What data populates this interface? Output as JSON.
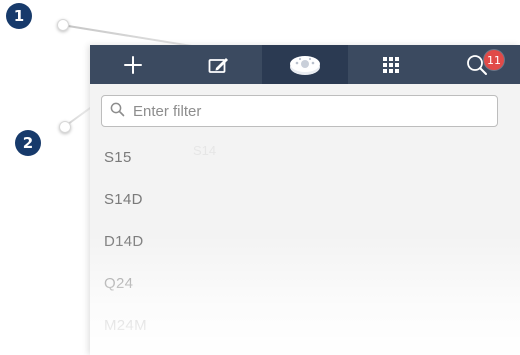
{
  "callouts": [
    {
      "number": "1"
    },
    {
      "number": "2"
    }
  ],
  "toolbar": {
    "buttons": [
      {
        "name": "add",
        "icon": "plus-icon"
      },
      {
        "name": "edit",
        "icon": "edit-icon"
      },
      {
        "name": "cameras",
        "icon": "dome-camera-icon",
        "active": true
      },
      {
        "name": "grid",
        "icon": "grid-icon"
      },
      {
        "name": "search",
        "icon": "search-icon",
        "badge": "11"
      }
    ],
    "colors": {
      "background": "#3b4a60",
      "active": "#2b3a52",
      "badge": "#e14a48"
    }
  },
  "filter": {
    "placeholder": "Enter filter",
    "value": ""
  },
  "camera_list": {
    "items": [
      "S15",
      "S14D",
      "D14D",
      "Q24",
      "M24M"
    ]
  },
  "ghost_text": "S14"
}
